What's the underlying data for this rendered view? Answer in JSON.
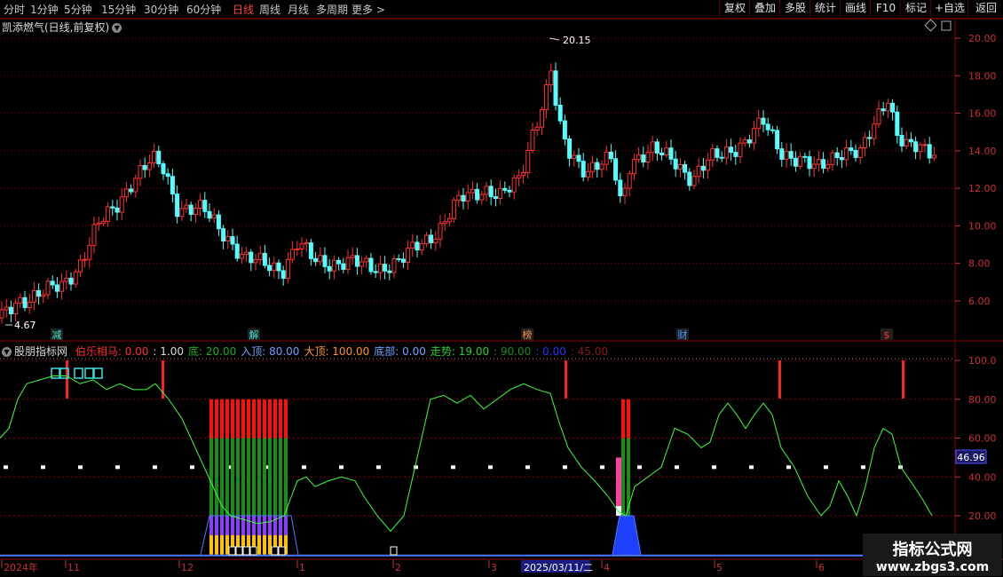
{
  "toolbar": {
    "periods": [
      "分时",
      "1分钟",
      "5分钟",
      "15分钟",
      "30分钟",
      "60分钟",
      "日线",
      "周线",
      "月线",
      "多周期",
      "更多 >"
    ],
    "active_period": "日线",
    "right_buttons": [
      "复权",
      "叠加",
      "多股",
      "统计",
      "画线",
      "F10",
      "标记",
      "+自选",
      "返回"
    ]
  },
  "main_chart": {
    "title": "凯添燃气(日线,前复权)",
    "y_ticks": [
      "20.00",
      "18.00",
      "16.00",
      "14.00",
      "12.00",
      "10.00",
      "8.00",
      "6.00"
    ],
    "high_label": "20.15",
    "low_label": "4.67",
    "event_markers": [
      {
        "label": "减",
        "color": "#40e0d0"
      },
      {
        "label": "解",
        "color": "#40e0d0"
      },
      {
        "label": "榜",
        "color": "#ff9040"
      },
      {
        "label": "财",
        "color": "#40a0ff"
      },
      {
        "label": "$",
        "color": "#ff3030"
      }
    ]
  },
  "indicator": {
    "name": "股朋指标网",
    "params": [
      {
        "label": "伯乐相马:",
        "value": "0.00",
        "color": "#ff3030"
      },
      {
        "label": ":",
        "value": "1.00",
        "color": "#dcdcdc"
      },
      {
        "label": "底:",
        "value": "20.00",
        "color": "#1fae1f"
      },
      {
        "label": "入顶:",
        "value": "80.00",
        "color": "#70a0ff"
      },
      {
        "label": "大顶:",
        "value": "100.00",
        "color": "#ff9030"
      },
      {
        "label": "底部:",
        "value": "0.00",
        "color": "#70a0ff"
      },
      {
        "label": "走势:",
        "value": "19.00",
        "color": "#30d030"
      },
      {
        "label": ":",
        "value": "90.00",
        "color": "#1c8c1c"
      },
      {
        "label": ":",
        "value": "0.00",
        "color": "#3030ff"
      },
      {
        "label": ":",
        "value": "45.00",
        "color": "#8b1a1a"
      }
    ],
    "y_ticks": [
      "100.0",
      "80.00",
      "60.00",
      "40.00",
      "20.00"
    ],
    "current_value": "46.96"
  },
  "time_axis": {
    "labels": [
      "2024年",
      "11",
      "12",
      "1",
      "2",
      "3",
      "2025/03/11/二",
      "4",
      "5",
      "6"
    ]
  },
  "watermark": {
    "line1": "指标公式网",
    "line2": "www.zbgs3.com"
  },
  "colors": {
    "up": "#ff3232",
    "down": "#54ffff",
    "grid": "#8b0000",
    "line": "#3cff3c"
  }
}
